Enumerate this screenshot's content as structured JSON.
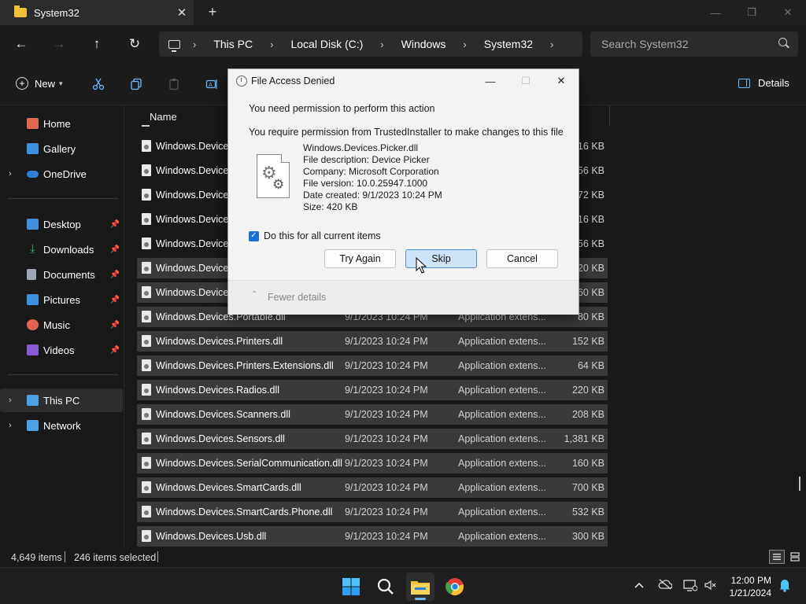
{
  "window": {
    "tab_title": "System32",
    "close_tab_glyph": "✕",
    "new_tab_glyph": "+",
    "minimize_glyph": "—",
    "maximize_glyph": "❐",
    "close_glyph": "✕"
  },
  "nav": {
    "back_glyph": "←",
    "forward_glyph": "→",
    "up_glyph": "↑",
    "refresh_glyph": "↻"
  },
  "address": {
    "crumbs": [
      "This PC",
      "Local Disk (C:)",
      "Windows",
      "System32"
    ],
    "separator": "›"
  },
  "search": {
    "placeholder": "Search System32"
  },
  "toolbar": {
    "new_label": "New",
    "details_label": "Details",
    "icons": [
      "cut-icon",
      "copy-icon",
      "paste-icon",
      "rename-icon"
    ]
  },
  "sidebar": {
    "items": [
      {
        "label": "Home",
        "icon": "home-icon",
        "color": "#e06a4d"
      },
      {
        "label": "Gallery",
        "icon": "gallery-icon",
        "color": "#3d8fe0"
      },
      {
        "label": "OneDrive",
        "icon": "onedrive-icon",
        "color": "#2f7fd8"
      },
      {
        "label": "Desktop",
        "icon": "desktop-icon",
        "color": "#3f8fdc"
      },
      {
        "label": "Downloads",
        "icon": "downloads-icon",
        "color": "#39b36b"
      },
      {
        "label": "Documents",
        "icon": "documents-icon",
        "color": "#9ea7b3"
      },
      {
        "label": "Pictures",
        "icon": "pictures-icon",
        "color": "#3d8fe0"
      },
      {
        "label": "Music",
        "icon": "music-icon",
        "color": "#e2644e"
      },
      {
        "label": "Videos",
        "icon": "videos-icon",
        "color": "#8a5ad6"
      },
      {
        "label": "This PC",
        "icon": "this-pc-icon",
        "color": "#4aa3e6"
      },
      {
        "label": "Network",
        "icon": "network-icon",
        "color": "#4aa3e6"
      }
    ]
  },
  "filelist": {
    "name_header": "Name",
    "rows": [
      {
        "name": "Windows.Devices",
        "date": "",
        "type": "",
        "size": "216 KB",
        "selected": false
      },
      {
        "name": "Windows.Devices",
        "date": "",
        "type": "",
        "size": "556 KB",
        "selected": false
      },
      {
        "name": "Windows.Devices",
        "date": "",
        "type": "",
        "size": "472 KB",
        "selected": false
      },
      {
        "name": "Windows.Devices",
        "date": "",
        "type": "",
        "size": "416 KB",
        "selected": false
      },
      {
        "name": "Windows.Devices",
        "date": "",
        "type": "",
        "size": "556 KB",
        "selected": false
      },
      {
        "name": "Windows.Devices",
        "date": "",
        "type": "",
        "size": "420 KB",
        "selected": true
      },
      {
        "name": "Windows.Devices",
        "date": "",
        "type": "",
        "size": "760 KB",
        "selected": true
      },
      {
        "name": "Windows.Devices.Portable.dll",
        "date": "9/1/2023 10:24 PM",
        "type": "Application extens...",
        "size": "80 KB",
        "selected": true
      },
      {
        "name": "Windows.Devices.Printers.dll",
        "date": "9/1/2023 10:24 PM",
        "type": "Application extens...",
        "size": "152 KB",
        "selected": true
      },
      {
        "name": "Windows.Devices.Printers.Extensions.dll",
        "date": "9/1/2023 10:24 PM",
        "type": "Application extens...",
        "size": "64 KB",
        "selected": true
      },
      {
        "name": "Windows.Devices.Radios.dll",
        "date": "9/1/2023 10:24 PM",
        "type": "Application extens...",
        "size": "220 KB",
        "selected": true
      },
      {
        "name": "Windows.Devices.Scanners.dll",
        "date": "9/1/2023 10:24 PM",
        "type": "Application extens...",
        "size": "208 KB",
        "selected": true
      },
      {
        "name": "Windows.Devices.Sensors.dll",
        "date": "9/1/2023 10:24 PM",
        "type": "Application extens...",
        "size": "1,381 KB",
        "selected": true
      },
      {
        "name": "Windows.Devices.SerialCommunication.dll",
        "date": "9/1/2023 10:24 PM",
        "type": "Application extens...",
        "size": "160 KB",
        "selected": true
      },
      {
        "name": "Windows.Devices.SmartCards.dll",
        "date": "9/1/2023 10:24 PM",
        "type": "Application extens...",
        "size": "700 KB",
        "selected": true
      },
      {
        "name": "Windows.Devices.SmartCards.Phone.dll",
        "date": "9/1/2023 10:24 PM",
        "type": "Application extens...",
        "size": "532 KB",
        "selected": true
      },
      {
        "name": "Windows.Devices.Usb.dll",
        "date": "9/1/2023 10:24 PM",
        "type": "Application extens...",
        "size": "300 KB",
        "selected": true
      }
    ]
  },
  "status": {
    "item_count": "4,649 items",
    "selected_count": "246 items selected"
  },
  "dialog": {
    "title": "File Access Denied",
    "message": "You need permission to perform this action",
    "detail": "You require permission from TrustedInstaller to make changes to this file",
    "file_name": "Windows.Devices.Picker.dll",
    "file_description": "File description: Device Picker",
    "company": "Company: Microsoft Corporation",
    "file_version": "File version: 10.0.25947.1000",
    "date_created": "Date created: 9/1/2023 10:24 PM",
    "size": "Size: 420 KB",
    "checkbox_label": "Do this for all current items",
    "checkbox_checked": true,
    "try_again_label": "Try Again",
    "skip_label": "Skip",
    "cancel_label": "Cancel",
    "fewer_details_label": "Fewer details",
    "minimize_glyph": "—",
    "maximize_glyph": "☐",
    "close_glyph": "✕"
  },
  "taskbar": {
    "apps": [
      "start-icon",
      "search-icon",
      "file-explorer-icon",
      "chrome-icon"
    ],
    "time": "12:00 PM",
    "date": "1/21/2024"
  },
  "colors": {
    "accent": "#6cb8ff",
    "dialog_bg": "#f3f3f3",
    "primary_button": "#cde3f9",
    "checkbox": "#1a6fd6",
    "folder": "#f3c13a"
  }
}
